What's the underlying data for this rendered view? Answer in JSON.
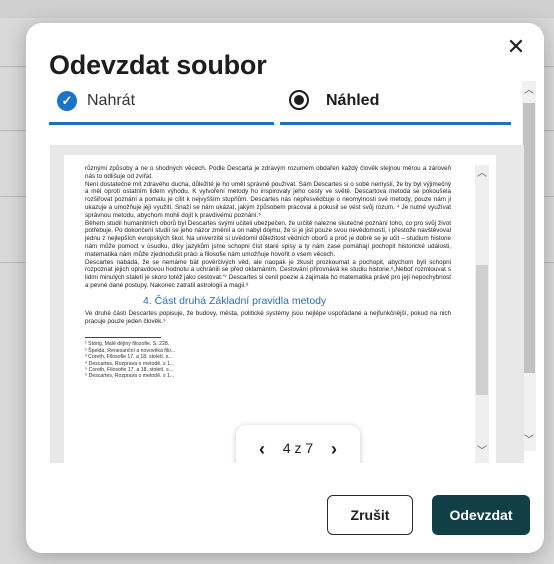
{
  "modal": {
    "title": "Odevzdat soubor",
    "close_icon": "close-icon"
  },
  "steps": [
    {
      "label": "Nahrát",
      "icon": "check-circle-icon",
      "state": "done"
    },
    {
      "label": "Náhled",
      "icon": "radio-selected-icon",
      "state": "active"
    }
  ],
  "colors": {
    "accent": "#1a73c8",
    "primary_button": "#123f45"
  },
  "document": {
    "paragraphs": [
      "různými způsoby a ne o shodných věcech. Podle Descarta je zdravým rozumem obdařen každý člověk stejnou měrou a zároveň nás to odlišuje od zvířat.",
      "Není dostatečné mít zdravého ducha, důležité je ho umět správně používat. Sám Descartes si o sobě nemyslí, že by byl výjimečný a měl oproti ostatním lidem výhodu. K vytvoření metody ho inspirovaly jeho cesty ve světě. Descartova metoda se pokoušela rozšiřovat poznání a pomalu je cílit k nejvyšším stupňům. Descartes nás nepřesvědčuje o neomylnosti své metody, pouze nám ji ukazuje a umožňuje její využití. Snaží se nám ukázat, jakým způsobem pracoval a pokusil se vést svůj rozum. ⁴ Je nutné využívat správnou metodu, abychom mohli dojít k pravdivému poznání.⁵",
      "Během studií humanitních oborů byl Descartes svými učiteli ubezpečen, že určitě nalezne skutečné poznání toho, co pro svůj život potřebuje. Po dokončení studií se jeho názor změnil a on nabyl dojmu, že si je jist pouze svou nevědomostí, i přestože navštěvoval jednu z nejlepších evropských škol. Na univerzitě si uvědomil důležitost vědních oborů a proč je dobré se je učit – studium historie nám může pomoct v úsudku, díky jazykům jsme schopni číst staré spisy a ty nám zase pomáhají pochopit historické události, matematika nám může zjednodušit práci a filosofie nám umožňuje hovořit o všem věcech.",
      "Descartes nabádá, že se nemáme bát pověrčivých věd, ale naopak je zkusit prozkoumat a pochopit, abychom byli schopni rozpoznat jejich opravdovou hodnotu a uchránili se před oklamáním. Cestování přirovnává ke studiu historie.⁶„Neboť rozmlouvat s lidmi minulých staletí je skoro totéž jako cestovat.“⁷ Descartes si cenil poezie a zajímala ho matematika právě pro její nepochybnost a pevné dané postupy. Nakonec zatratil astrologii a magii.⁸"
    ],
    "heading": "4. Část druhá Základní pravidla metody",
    "heading_paragraph": "Ve druhé části Descartes popisuje, že budovy, města, politické systémy jsou nejlépe uspořádané a nejfunkčnější, pokud na nich pracuje pouze jeden člověk.⁹",
    "footnotes": [
      "¹ Störig, Malé dějiny filozofie. S. 228.",
      "² Špelda, Renesanční a novověká filo...",
      "³ Coreth, Filosofie 17. a 18. století. s...",
      "⁴ Descartes, Rozprava o metodě. s 1...",
      "⁵ Coreth, Filosofie 17. a 18. století. s...",
      "⁶ Descartes, Rozprava o metodě. s 1..."
    ]
  },
  "pager": {
    "text": "4 z 7",
    "prev_icon": "chevron-left-icon",
    "next_icon": "chevron-right-icon"
  },
  "buttons": {
    "cancel": "Zrušit",
    "submit": "Odevzdat"
  }
}
